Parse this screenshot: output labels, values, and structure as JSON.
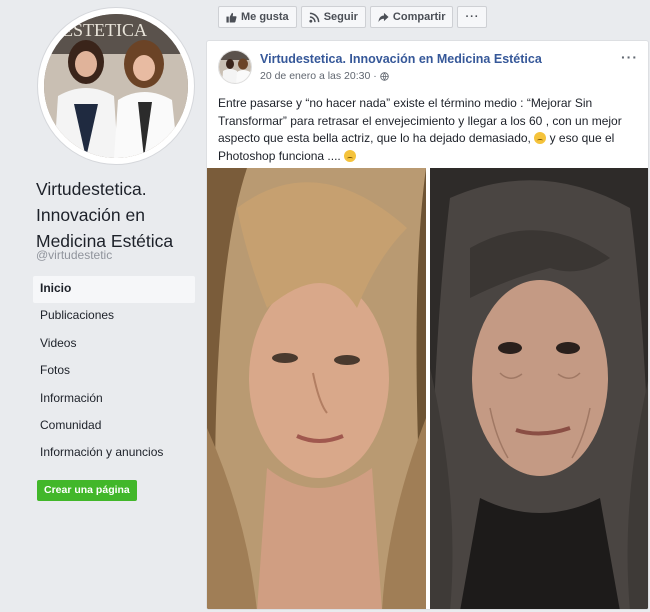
{
  "sidebar": {
    "page_name_lines": [
      "Virtudestetica.",
      "Innovación en",
      "Medicina Estética"
    ],
    "handle": "@virtudestetic",
    "logo_text": "ESTETICA",
    "nav_items": [
      {
        "label": "Inicio",
        "active": true
      },
      {
        "label": "Publicaciones",
        "active": false
      },
      {
        "label": "Videos",
        "active": false
      },
      {
        "label": "Fotos",
        "active": false
      },
      {
        "label": "Información",
        "active": false
      },
      {
        "label": "Comunidad",
        "active": false
      },
      {
        "label": "Información y anuncios",
        "active": false
      }
    ],
    "create_page_label": "Crear una página"
  },
  "actions": {
    "like_label": "Me gusta",
    "follow_label": "Seguir",
    "share_label": "Compartir",
    "more_label": "···"
  },
  "post": {
    "author": "Virtudestetica. Innovación en Medicina Estética",
    "timestamp": "20 de enero a las 20:30 ·",
    "options_label": "···",
    "text_line1": "Entre pasarse y “no hacer nada” existe el término medio : “Mejorar Sin",
    "text_line2": "Transformar” para retrasar el envejecimiento y llegar a los 60 , con un mejor",
    "text_line3a": "aspecto que esta bella actriz, que lo ha dejado demasiado,",
    "text_line3b": "y eso que el",
    "text_line4": "Photoshop funciona ....",
    "emoji_names": [
      "disappointed-face",
      "winking-tongue-face"
    ]
  },
  "colors": {
    "link_blue": "#365899",
    "create_green": "#42b72a",
    "page_bg": "#e9ebee"
  }
}
